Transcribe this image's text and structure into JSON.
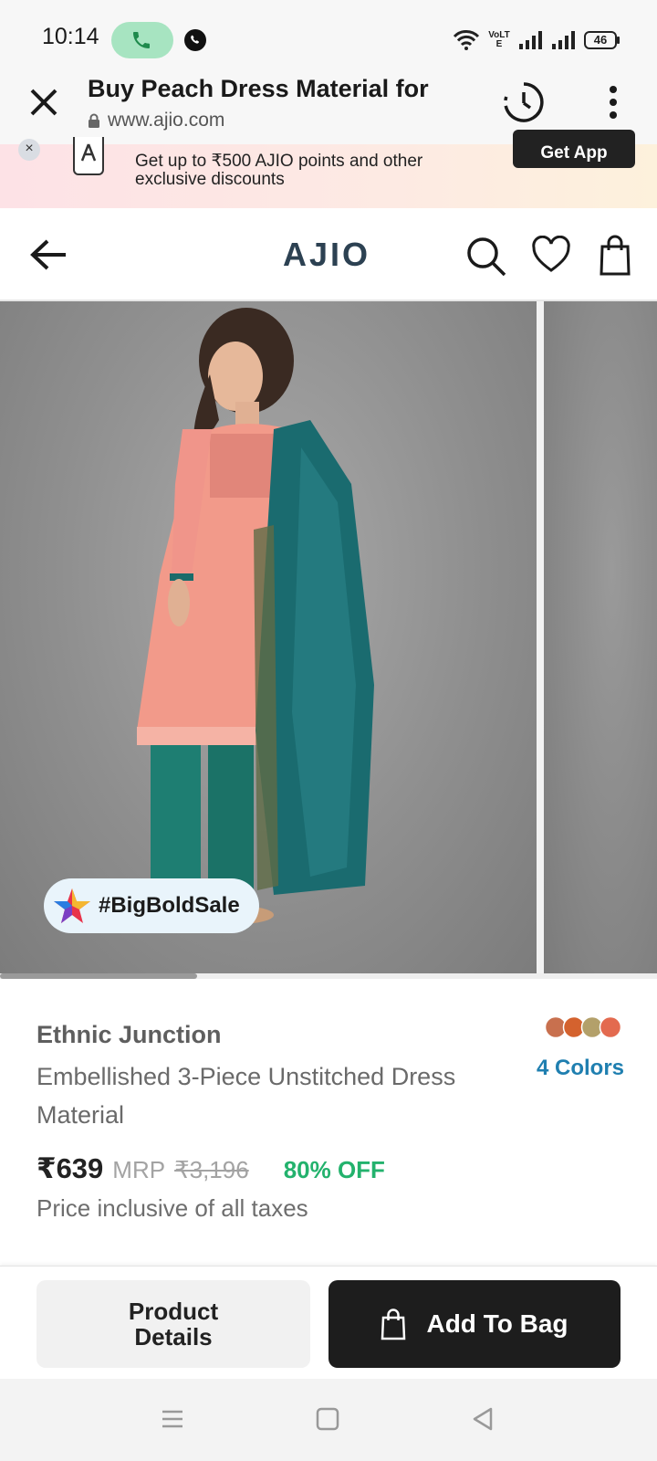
{
  "status_bar": {
    "time": "10:14",
    "battery": "46",
    "network_label": "VoLTE"
  },
  "browser": {
    "page_title": "Buy Peach Dress Material for",
    "url": "www.ajio.com"
  },
  "app_banner": {
    "text": "Get up to ₹500 AJIO points and other exclusive discounts",
    "cta": "Get App",
    "close_label": "×"
  },
  "header": {
    "logo": "AJIO"
  },
  "carousel": {
    "sale_tag": "#BigBoldSale",
    "current_slide_fraction": 0.3
  },
  "product": {
    "brand": "Ethnic Junction",
    "name": "Embellished 3-Piece Unstitched Dress Material",
    "colors_label": "4 Colors",
    "swatch_colors": [
      "#c8704e",
      "#d4622e",
      "#b3a06a",
      "#e36a4f"
    ],
    "price": "₹639",
    "mrp_label": "MRP",
    "mrp_value": "₹3,196",
    "discount": "80% OFF",
    "tax_note": "Price inclusive of all taxes"
  },
  "actions": {
    "details_label": "Product Details",
    "add_to_bag_label": "Add To Bag"
  },
  "colors": {
    "accent_blue": "#1f7fb0",
    "discount_green": "#23b26d",
    "logo_color": "#2c4152",
    "call_pill": "#a7e4c1"
  }
}
